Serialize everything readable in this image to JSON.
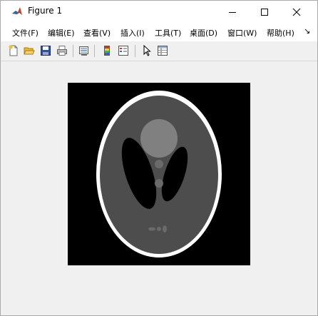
{
  "window": {
    "title": "Figure 1"
  },
  "menu": {
    "items": [
      "文件(F)",
      "编辑(E)",
      "查看(V)",
      "插入(I)",
      "工具(T)",
      "桌面(D)",
      "窗口(W)",
      "帮助(H)"
    ],
    "overflow_glyph": "↘"
  },
  "toolbar": {
    "buttons": [
      "new-figure",
      "open-file",
      "save-figure",
      "print-figure",
      "link-plot",
      "insert-colorbar",
      "insert-legend",
      "edit-plot",
      "open-property-inspector"
    ]
  },
  "figure": {
    "image_description_colors": {
      "background": "#000000",
      "skull": "#ffffff",
      "brain": "#4d4d4d",
      "ventricles": "#000000",
      "region": "#808080"
    }
  }
}
